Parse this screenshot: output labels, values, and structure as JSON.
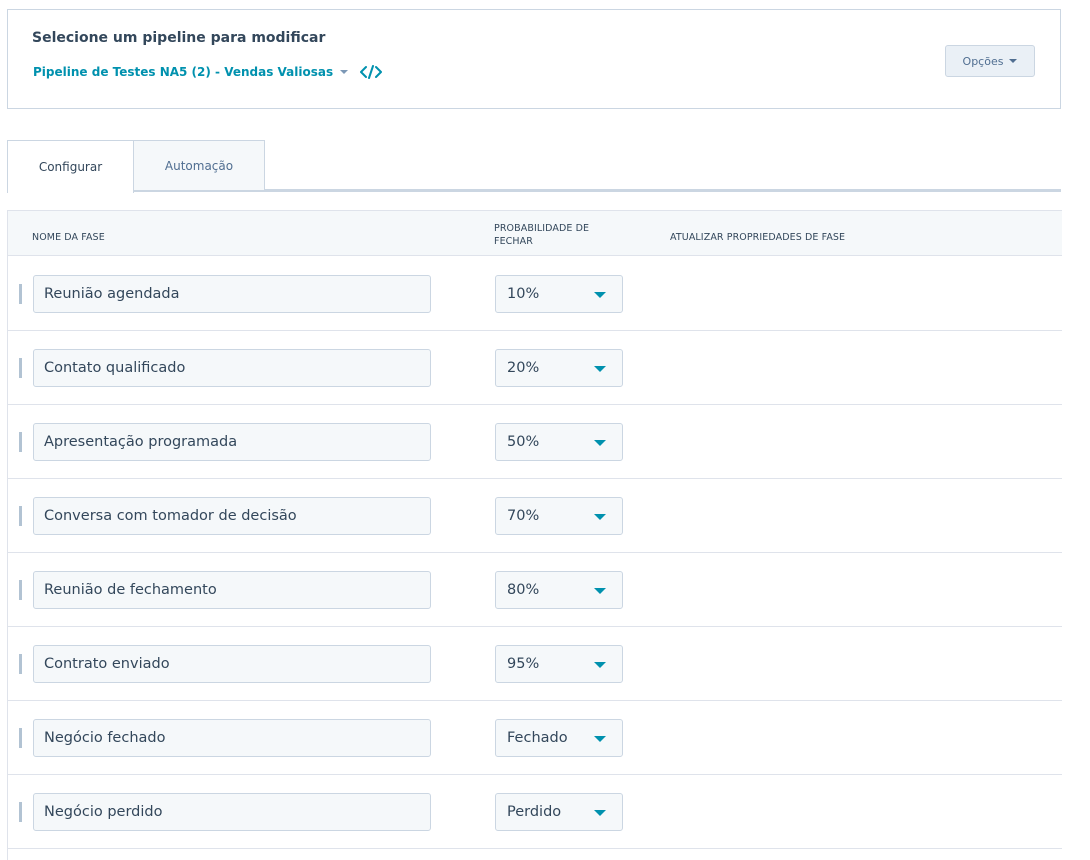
{
  "header": {
    "heading": "Selecione um pipeline para modificar",
    "pipeline_name": "Pipeline de Testes NA5 (2) - Vendas Valiosas",
    "options_label": "Opções"
  },
  "tabs": [
    {
      "label": "Configurar",
      "active": true
    },
    {
      "label": "Automação",
      "active": false
    }
  ],
  "table": {
    "columns": {
      "name": "NOME DA FASE",
      "probability": "PROBABILIDADE DE FECHAR",
      "update": "ATUALIZAR PROPRIEDADES DE FASE"
    },
    "rows": [
      {
        "name": "Reunião agendada",
        "probability": "10%"
      },
      {
        "name": "Contato qualificado",
        "probability": "20%"
      },
      {
        "name": "Apresentação programada",
        "probability": "50%"
      },
      {
        "name": "Conversa com tomador de decisão",
        "probability": "70%"
      },
      {
        "name": "Reunião de fechamento",
        "probability": "80%"
      },
      {
        "name": "Contrato enviado",
        "probability": "95%"
      },
      {
        "name": "Negócio fechado",
        "probability": "Fechado"
      },
      {
        "name": "Negócio perdido",
        "probability": "Perdido"
      }
    ]
  },
  "colors": {
    "accent": "#0091ae",
    "text": "#33475b",
    "border": "#cbd6e2",
    "input_bg": "#f5f8fa"
  }
}
